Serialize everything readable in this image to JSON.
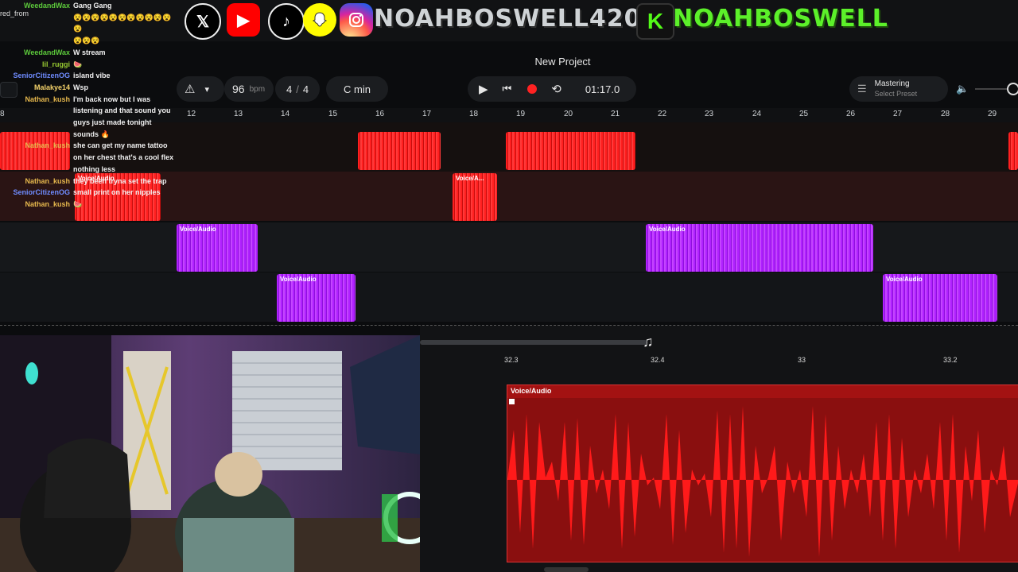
{
  "banner": {
    "handle1": "NOAHBOSWELL420",
    "handle2": "NOAHBOSWELL",
    "kick_letter": "K",
    "socials": [
      {
        "name": "x",
        "glyph": "𝕏",
        "bg": "#000000",
        "fg": "#ffffff"
      },
      {
        "name": "youtube",
        "glyph": "▶",
        "bg": "#ff0000",
        "fg": "#ffffff"
      },
      {
        "name": "tiktok",
        "glyph": "♪",
        "bg": "#000000",
        "fg": "#ffffff"
      },
      {
        "name": "snapchat",
        "glyph": "👻",
        "bg": "#fffc00",
        "fg": "#ffffff"
      },
      {
        "name": "instagram",
        "glyph": "◎",
        "bg": "#d6249f",
        "fg": "#ffffff"
      }
    ]
  },
  "chat": {
    "overlay_text": "red_from",
    "messages": [
      {
        "user": "WeedandWax",
        "msg": "Gang Gang",
        "color": "#5cc93b"
      },
      {
        "user": "",
        "msg": "😵😵😵😵😵😵😵😵😵😵😵😵",
        "color": "#5cc93b"
      },
      {
        "user": "",
        "msg": "😵😵😵",
        "color": "#5cc93b"
      },
      {
        "user": "WeedandWax",
        "msg": "W stream",
        "color": "#5cc93b"
      },
      {
        "user": "lil_ruggi",
        "msg": "🍉",
        "color": "#9acd32"
      },
      {
        "user": "SeniorCitizenOG",
        "msg": "island vibe",
        "color": "#6f8cff"
      },
      {
        "user": "Malakye14",
        "msg": "Wsp",
        "color": "#f5d36b"
      },
      {
        "user": "Nathan_kush",
        "msg": "I'm back now but I was listening and that sound you guys just made tonight sounds 🔥",
        "color": "#e6b84d"
      },
      {
        "user": "Nathan_kush",
        "msg": "she can get my name tattoo on her chest that's a cool flex nothing less",
        "color": "#e6b84d"
      },
      {
        "user": "Nathan_kush",
        "msg": "they been tryna set the trap",
        "color": "#e6b84d"
      },
      {
        "user": "SeniorCitizenOG",
        "msg": "small print on her nipples",
        "color": "#6f8cff"
      },
      {
        "user": "Nathan_kush",
        "msg": "🍉",
        "color": "#e6b84d"
      }
    ]
  },
  "daw": {
    "project_title": "New Project",
    "bpm_value": "96",
    "bpm_unit": "bpm",
    "time_sig_num": "4",
    "time_sig_sep": "/",
    "time_sig_den": "4",
    "key": "C min",
    "time_display": "01:17.0",
    "mastering_label": "Mastering",
    "mastering_preset": "Select Preset",
    "ruler_ticks": [
      "12",
      "13",
      "14",
      "15",
      "16",
      "17",
      "18",
      "19",
      "20",
      "21",
      "22",
      "23",
      "24",
      "25",
      "26",
      "27",
      "28",
      "29"
    ],
    "clip_label": "Voice/Audio",
    "clip_label_short": "Voice/A...",
    "zoom_ticks": [
      "32.3",
      "32.4",
      "33",
      "33.2"
    ],
    "colors": {
      "red": "#ff1f1f",
      "purple": "#b020ff",
      "accent": "#ff2222"
    }
  }
}
